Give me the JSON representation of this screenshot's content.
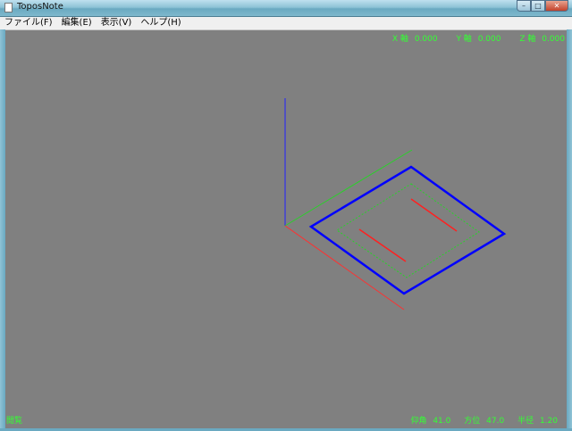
{
  "window": {
    "title": "ToposNote",
    "minimize": "–",
    "maximize": "□",
    "close": "✕"
  },
  "menu": [
    "ファイル(F)",
    "編集(E)",
    "表示(V)",
    "ヘルプ(H)"
  ],
  "coords": {
    "x_label": "X 軸",
    "x_value": "0.000",
    "y_label": "Y 軸",
    "y_value": "0.000",
    "z_label": "Z 軸",
    "z_value": "0.000"
  },
  "status": {
    "left": "閲覧",
    "elevation_label": "仰角",
    "elevation_value": "41.0",
    "azimuth_label": "方位",
    "azimuth_value": "47.0",
    "radius_label": "半径",
    "radius_value": "1.20"
  },
  "colors": {
    "x_axis": "#ff3030",
    "y_axis": "#2ad02a",
    "z_axis": "#2020ff",
    "shape": "#0000ff",
    "hud": "#33ff33"
  }
}
